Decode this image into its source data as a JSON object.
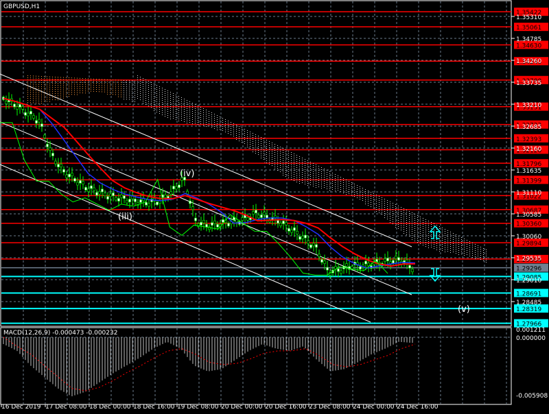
{
  "symbol_title": "GBPUSD,H1",
  "macd_title": "MACD(12,26,9) -0.000473 -0.000232",
  "colors": {
    "bg": "#000000",
    "grid": "#6b7b8c",
    "red": "#ff0000",
    "cyan": "#00ffff",
    "gray": "#708090",
    "candle": "#00ff00",
    "ma_red": "#ff0000",
    "ma_blue": "#2030ff"
  },
  "chart_data": {
    "type": "candlestick",
    "price_axis_ticks": [
      "1.35310",
      "1.34785",
      "1.34260",
      "1.33735",
      "1.33210",
      "1.32685",
      "1.32160",
      "1.31635",
      "1.31110",
      "1.30585",
      "1.30060",
      "1.29535",
      "1.29010",
      "1.28485"
    ],
    "level_lines": [
      {
        "price": "1.35422",
        "color": "red"
      },
      {
        "price": "1.35061",
        "color": "red"
      },
      {
        "price": "1.34630",
        "color": "red"
      },
      {
        "price": "1.34240",
        "color": "red"
      },
      {
        "price": "1.33788",
        "color": "red"
      },
      {
        "price": "1.33151",
        "color": "red"
      },
      {
        "price": "1.32723",
        "color": "red"
      },
      {
        "price": "1.32393",
        "color": "red"
      },
      {
        "price": "1.32120",
        "color": "red"
      },
      {
        "price": "1.31796",
        "color": "red"
      },
      {
        "price": "1.31399",
        "color": "red"
      },
      {
        "price": "1.31022",
        "color": "red"
      },
      {
        "price": "1.30687",
        "color": "red"
      },
      {
        "price": "1.30360",
        "color": "red"
      },
      {
        "price": "1.29894",
        "color": "red"
      },
      {
        "price": "1.29504",
        "color": "red"
      },
      {
        "price": "1.29296",
        "color": "gray"
      },
      {
        "price": "1.29085",
        "color": "cyan"
      },
      {
        "price": "1.28691",
        "color": "cyan"
      },
      {
        "price": "1.28319",
        "color": "cyan"
      },
      {
        "price": "1.27966",
        "color": "cyan"
      }
    ],
    "time_labels": [
      "16 Dec 2019",
      "17 Dec 08:00",
      "18 Dec 00:00",
      "18 Dec 16:00",
      "19 Dec 08:00",
      "20 Dec 00:00",
      "20 Dec 16:00",
      "23 Dec 08:00",
      "24 Dec 00:00",
      "24 Dec 16:00"
    ],
    "close_series": [
      1.3335,
      1.332,
      1.33,
      1.328,
      1.32,
      1.316,
      1.314,
      1.312,
      1.311,
      1.31,
      1.3095,
      1.309,
      1.3085,
      1.309,
      1.311,
      1.3144,
      1.304,
      1.303,
      1.3035,
      1.304,
      1.3045,
      1.306,
      1.305,
      1.304,
      1.302,
      1.3,
      1.2977,
      1.292,
      1.2925,
      1.2935,
      1.2935,
      1.294,
      1.2945,
      1.295,
      1.2929
    ],
    "macd_axis": [
      "0.001211",
      "0.000000",
      "-0.005908"
    ],
    "macd_hist": [
      -0.0006,
      -0.0012,
      -0.0025,
      -0.0035,
      -0.0045,
      -0.0052,
      -0.0048,
      -0.004,
      -0.0032,
      -0.0025,
      -0.0018,
      -0.001,
      -0.0004,
      -0.001,
      -0.0025,
      -0.003,
      -0.0028,
      -0.002,
      -0.0012,
      -0.0006,
      -0.001,
      -0.0012,
      -0.0008,
      -0.002,
      -0.003,
      -0.0028,
      -0.0022,
      -0.0015,
      -0.001,
      -0.0004,
      -0.0005
    ],
    "macd_signal": [
      0.0,
      -0.0008,
      -0.0015,
      -0.0025,
      -0.0035,
      -0.0045,
      -0.0047,
      -0.0044,
      -0.0038,
      -0.0031,
      -0.0025,
      -0.0018,
      -0.0012,
      -0.001,
      -0.0015,
      -0.0022,
      -0.0024,
      -0.0023,
      -0.0019,
      -0.0014,
      -0.0012,
      -0.0012,
      -0.001,
      -0.0016,
      -0.0024,
      -0.0026,
      -0.0024,
      -0.002,
      -0.0016,
      -0.001,
      -0.0006
    ],
    "annotations": [
      "(iii)",
      "(iv)",
      "(v)"
    ]
  }
}
